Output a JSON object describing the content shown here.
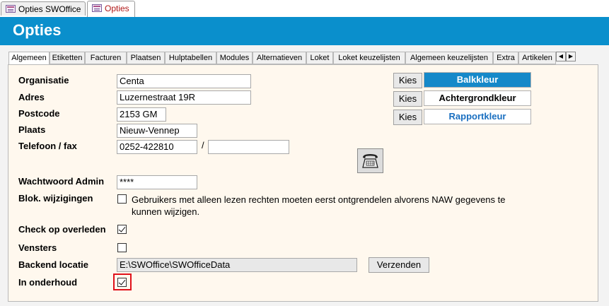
{
  "doc_tabs": [
    {
      "label": "Opties SWOffice",
      "active": false
    },
    {
      "label": "Opties",
      "active": true
    }
  ],
  "header": {
    "title": "Opties",
    "color": "#0a8fcc"
  },
  "tabs": [
    "Algemeen",
    "Etiketten",
    "Facturen",
    "Plaatsen",
    "Hulptabellen",
    "Modules",
    "Alternatieven",
    "Loket",
    "Loket keuzelijsten",
    "Algemeen keuzelijsten",
    "Extra",
    "Artikelen"
  ],
  "form": {
    "organisatie": {
      "label": "Organisatie",
      "value": "Centa"
    },
    "adres": {
      "label": "Adres",
      "value": "Luzernestraat 19R"
    },
    "postcode": {
      "label": "Postcode",
      "value": "2153 GM"
    },
    "plaats": {
      "label": "Plaats",
      "value": "Nieuw-Vennep"
    },
    "telefoon": {
      "label": "Telefoon / fax",
      "value": "0252-422810",
      "separator": "/",
      "fax": ""
    },
    "wachtwoord": {
      "label": "Wachtwoord Admin",
      "value": "****"
    },
    "blok": {
      "label": "Blok. wijzigingen",
      "checked": false,
      "line1": "Gebruikers met alleen lezen rechten moeten eerst ontgrendelen alvorens NAW gegevens te",
      "line2": "kunnen wijzigen."
    },
    "check_overleden": {
      "label": "Check op overleden",
      "checked": true
    },
    "vensters": {
      "label": "Vensters",
      "checked": false
    },
    "backend": {
      "label": "Backend locatie",
      "value": "E:\\SWOffice\\SWOfficeData",
      "button": "Verzenden"
    },
    "onderhoud": {
      "label": "In onderhoud",
      "checked": true
    }
  },
  "colors": {
    "kies_label": "Kies",
    "balkkleur": {
      "label": "Balkkleur",
      "bg": "#1589c9",
      "fg": "#ffffff"
    },
    "achtergrondkleur": {
      "label": "Achtergrondkleur",
      "bg": "#ffffff",
      "fg": "#000000"
    },
    "rapportkleur": {
      "label": "Rapportkleur",
      "bg": "#ffffff",
      "fg": "#1a6fc0"
    }
  },
  "icons": {
    "phone": "telephone-icon",
    "form": "form-icon"
  },
  "accent": {
    "highlight": "#e0111a"
  }
}
